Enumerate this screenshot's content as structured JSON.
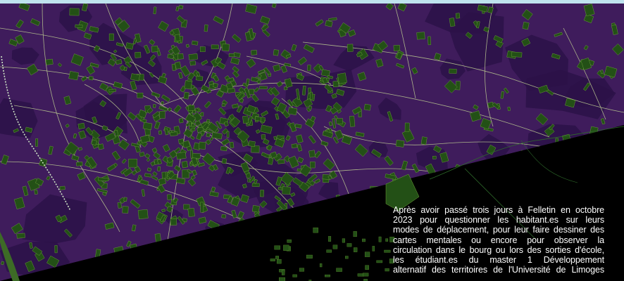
{
  "colors": {
    "land": "#3f1c5c",
    "land_dark": "#2c1248",
    "buildings": "#235016",
    "building_edge": "#6fa63a",
    "roads": "#b7c48f",
    "rail": "#cfe6c6",
    "green_area": "#3d6b26",
    "outside": "#000000",
    "top_bar": "#bfe3ee",
    "text": "#ffffff"
  },
  "map": {
    "subject": "Felletin town map",
    "style": "dark purple base with green building footprints"
  },
  "intro": {
    "lines": [
      "Après avoir passé trois jours à Felletin en octobre",
      "2023 pour questionner les habitant.es sur leurs",
      "modes de déplacement, pour leur faire dessiner des",
      "cartes mentales ou encore pour observer la",
      "circulation dans le bourg ou lors des sorties d'école,",
      "les étudiant.es du master 1 Développement",
      "alternatif des territoires de l'Université de Limoges"
    ]
  }
}
